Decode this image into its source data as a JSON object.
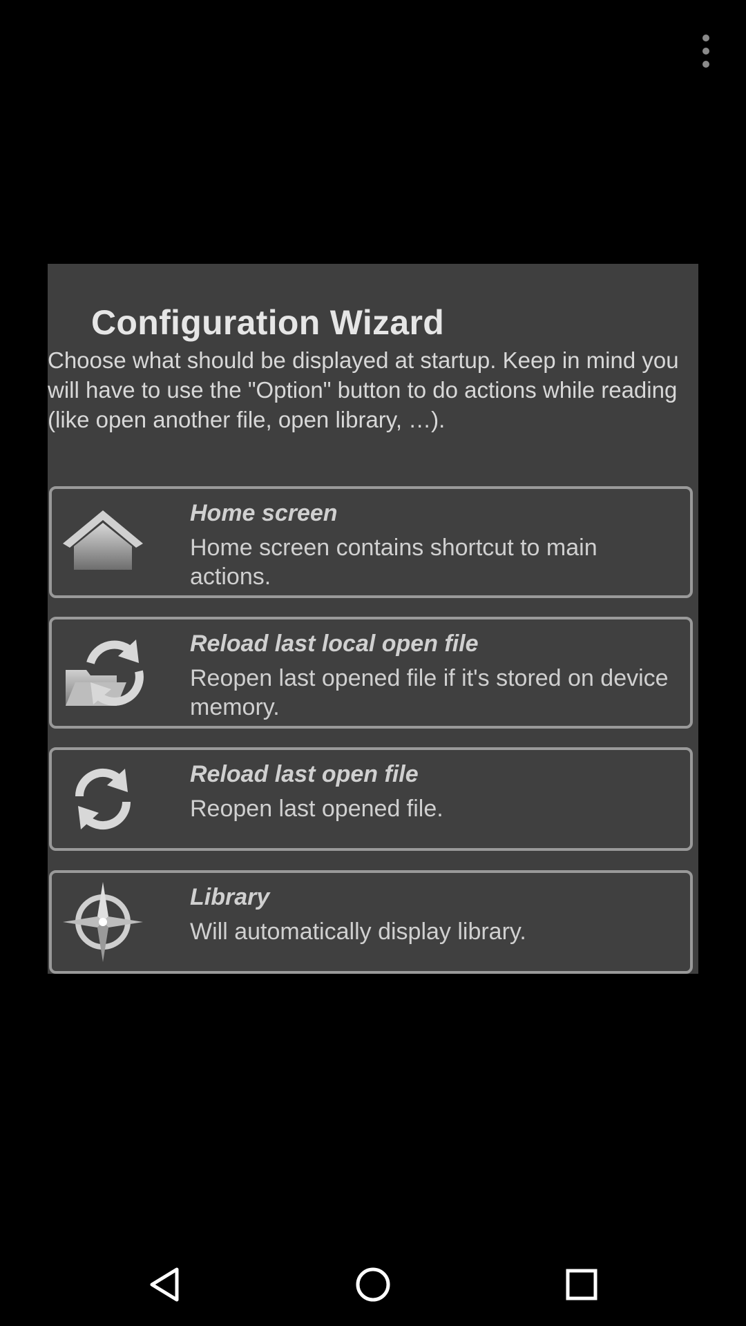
{
  "app_bar": {
    "overflow_icon": "more-vert-icon"
  },
  "dialog": {
    "title": "Configuration Wizard",
    "description": "Choose what should be displayed at startup. Keep in mind you will have to use the \"Option\" button to do actions while reading (like open another file, open library, …).",
    "options": [
      {
        "icon": "home-icon",
        "title": "Home screen",
        "description": "Home screen contains shortcut to main actions."
      },
      {
        "icon": "folder-refresh-icon",
        "title": "Reload last local open file",
        "description": "Reopen last opened file if it's stored on device memory."
      },
      {
        "icon": "refresh-icon",
        "title": "Reload last open file",
        "description": "Reopen last opened file."
      },
      {
        "icon": "compass-icon",
        "title": "Library",
        "description": "Will automatically display library."
      }
    ]
  },
  "nav_bar": {
    "back_icon": "back-triangle-icon",
    "home_icon": "home-circle-icon",
    "recents_icon": "recents-square-icon"
  },
  "colors": {
    "background": "#000000",
    "dialog_background": "#3f3f3f",
    "option_border": "#9a9a9a",
    "text": "#d0d0d0"
  }
}
